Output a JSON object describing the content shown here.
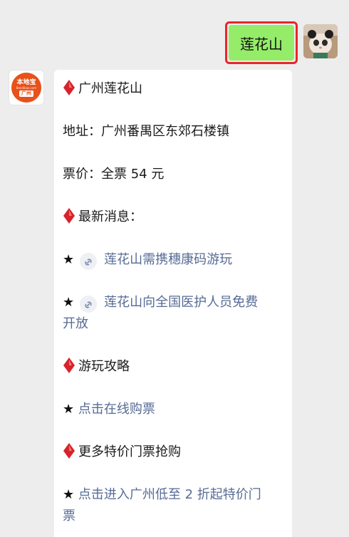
{
  "user_message": {
    "text": "莲花山"
  },
  "bot_message": {
    "title": "广州莲花山",
    "address": "地址：广州番禺区东郊石楼镇",
    "price": "票价：全票 54 元",
    "news_heading": "最新消息：",
    "news_link_1": "莲花山需携穗康码游玩",
    "news_link_2_line1": "莲花山向全国医护人员免费",
    "news_link_2_line2": "开放",
    "guide_heading": "游玩攻略",
    "guide_link": "点击在线购票",
    "deals_heading": "更多特价门票抢购",
    "deals_link_line1": "点击进入广州低至 2 折起特价门",
    "deals_link_line2": "票",
    "star": "★"
  },
  "bot_avatar": {
    "logo_top": "本地宝",
    "logo_mid": "Bendibao.com",
    "logo_bottom": "广州"
  },
  "colors": {
    "user_bubble": "#95ec69",
    "highlight_border": "#e8262c",
    "link": "#576b95",
    "diamond": "#d8232a",
    "logo": "#e8511a"
  },
  "icons": {
    "diamond": "diamond-icon",
    "link": "link-icon",
    "avatar": "user-avatar-cat"
  }
}
